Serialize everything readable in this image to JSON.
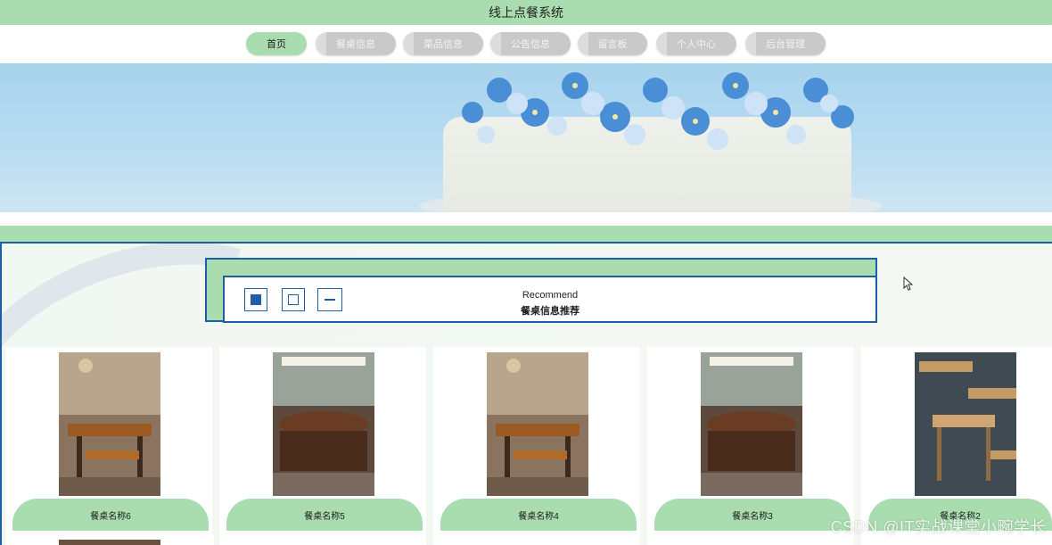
{
  "app": {
    "title": "线上点餐系统"
  },
  "nav": {
    "items": [
      {
        "label": "首页",
        "active": true
      },
      {
        "label": "餐桌信息"
      },
      {
        "label": "菜品信息"
      },
      {
        "label": "公告信息"
      },
      {
        "label": "留言板"
      },
      {
        "label": "个人中心"
      },
      {
        "label": "后台管理"
      }
    ]
  },
  "recommend": {
    "title_en": "Recommend",
    "title_cn": "餐桌信息推荐"
  },
  "tables": [
    {
      "name": "餐桌名称6",
      "photo": "restaurant-table-photo"
    },
    {
      "name": "餐桌名称5",
      "photo": "round-banquet-table-photo"
    },
    {
      "name": "餐桌名称4",
      "photo": "restaurant-table-photo"
    },
    {
      "name": "餐桌名称3",
      "photo": "round-banquet-table-photo"
    },
    {
      "name": "餐桌名称2",
      "photo": "wooden-tables-photo"
    }
  ],
  "watermark": "CSDN @IT实战课堂小畹学长",
  "colors": {
    "accent": "#a9dcae",
    "border": "#1d5fa6"
  }
}
